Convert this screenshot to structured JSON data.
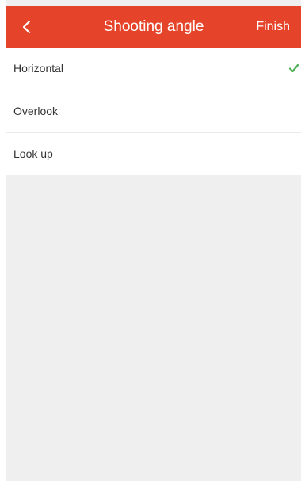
{
  "header": {
    "title": "Shooting angle",
    "finish_label": "Finish",
    "back_icon": "chevron-left-icon"
  },
  "options": [
    {
      "label": "Horizontal",
      "selected": true
    },
    {
      "label": "Overlook",
      "selected": false
    },
    {
      "label": "Look up",
      "selected": false
    }
  ],
  "colors": {
    "header_bg": "#e5442a",
    "check": "#4caf50",
    "page_bg": "#efefef"
  }
}
